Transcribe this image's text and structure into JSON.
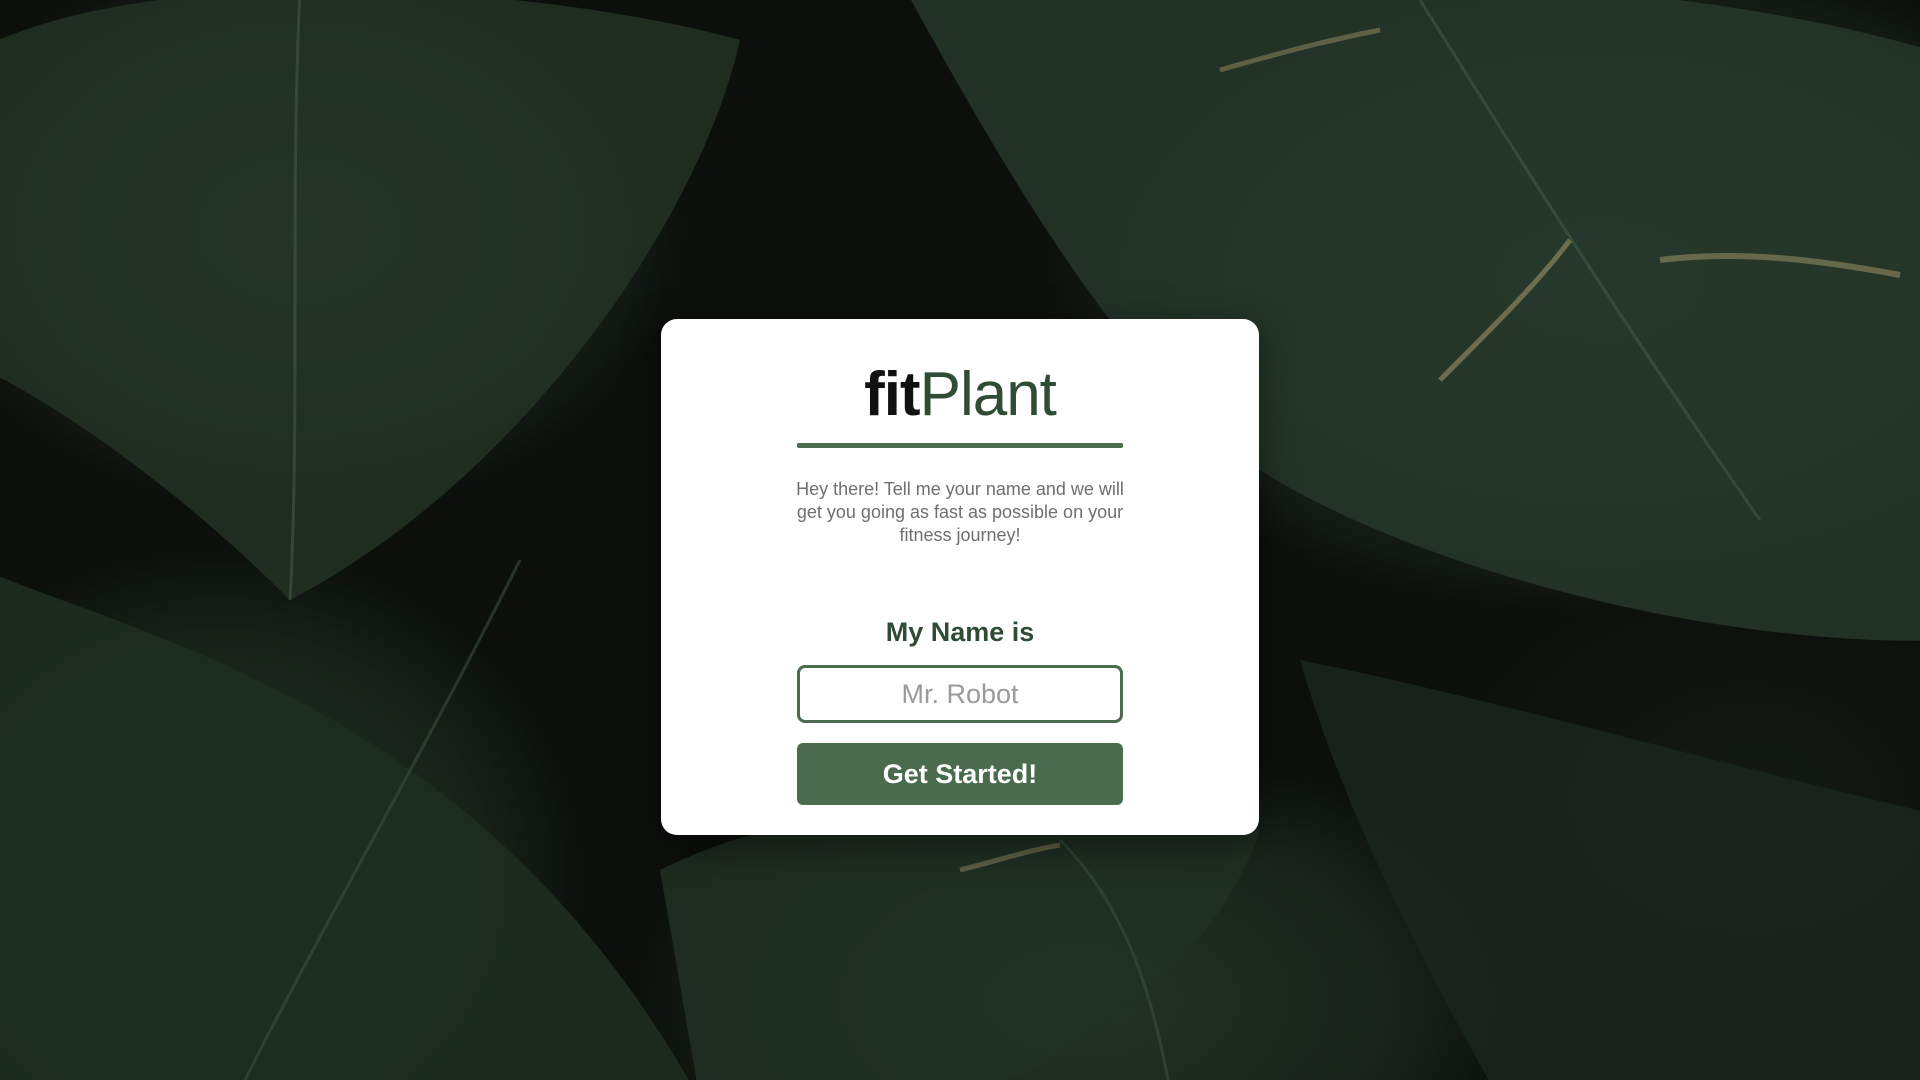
{
  "brand": {
    "prefix": "fit",
    "accent": "Plant",
    "accent_color": "#2f4c35"
  },
  "intro_text": "Hey there! Tell me your name and we will get you going as fast as possible on your fitness journey!",
  "form": {
    "label": "My Name is",
    "name_value": "",
    "name_placeholder": "Mr. Robot",
    "submit_label": "Get Started!"
  },
  "theme": {
    "primary": "#4a6b4d",
    "card_background": "#ffffff",
    "page_background": "dark green leaves photo"
  }
}
